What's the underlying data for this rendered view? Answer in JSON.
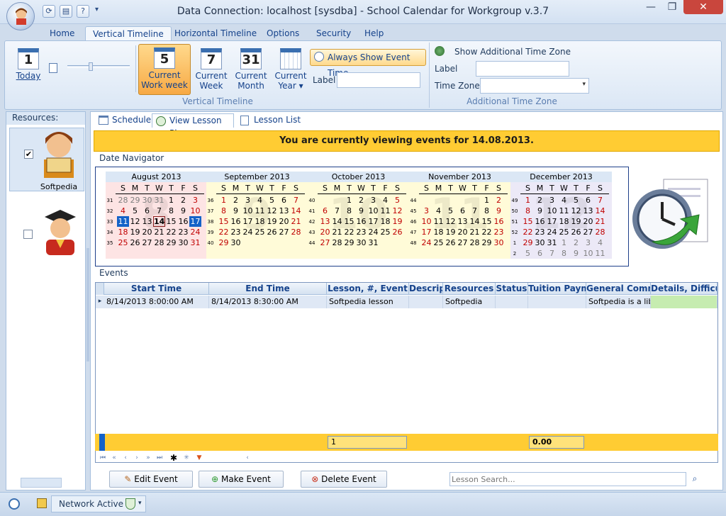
{
  "window": {
    "title": "Data Connection: localhost [sysdba] - School Calendar for Workgroup v.3.7"
  },
  "ribbon_tabs": [
    "Home",
    "Vertical Timeline",
    "Horizontal Timeline",
    "Options",
    "Security",
    "Help"
  ],
  "ribbon": {
    "today_num": "1",
    "today_label": "Today",
    "work_week_num": "5",
    "work_week_label1": "Current",
    "work_week_label2": "Work week",
    "week_num": "7",
    "week_label1": "Current",
    "week_label2": "Week",
    "month_num": "31",
    "month_label1": "Current",
    "month_label2": "Month",
    "year_label1": "Current",
    "year_label2": "Year",
    "always_show": "Always Show Event Time",
    "label_caption": "Label",
    "group_vertical": "Vertical Timeline",
    "show_additional": "Show Additional Time Zone",
    "tz_label": "Label",
    "tz_zone": "Time Zone",
    "group_additional": "Additional Time Zone"
  },
  "sidebar": {
    "header": "Resources:",
    "items": [
      {
        "name": "Softpedia",
        "checked": "✔"
      },
      {
        "name": "",
        "checked": ""
      }
    ]
  },
  "content_tabs": [
    "Scheduler",
    "View Lesson Plans",
    "Lesson List"
  ],
  "banner": "You are currently viewing events for 14.08.2013.",
  "date_navigator_label": "Date Navigator",
  "events_label": "Events",
  "day_headers": [
    "S",
    "M",
    "T",
    "W",
    "T",
    "F",
    "S"
  ],
  "months": [
    {
      "title": "August 2013",
      "bg": "8",
      "weeks": [
        "31",
        "32",
        "33",
        "34",
        "35"
      ],
      "rows": [
        [
          "28",
          "29",
          "30",
          "31",
          "1",
          "2",
          "3"
        ],
        [
          "4",
          "5",
          "6",
          "7",
          "8",
          "9",
          "10"
        ],
        [
          "11",
          "12",
          "13",
          "14",
          "15",
          "16",
          "17"
        ],
        [
          "18",
          "19",
          "20",
          "21",
          "22",
          "23",
          "24"
        ],
        [
          "25",
          "26",
          "27",
          "28",
          "29",
          "30",
          "31"
        ]
      ]
    },
    {
      "title": "September 2013",
      "bg": "9",
      "weeks": [
        "36",
        "37",
        "38",
        "39",
        "40"
      ],
      "rows": [
        [
          "1",
          "2",
          "3",
          "4",
          "5",
          "6",
          "7"
        ],
        [
          "8",
          "9",
          "10",
          "11",
          "12",
          "13",
          "14"
        ],
        [
          "15",
          "16",
          "17",
          "18",
          "19",
          "20",
          "21"
        ],
        [
          "22",
          "23",
          "24",
          "25",
          "26",
          "27",
          "28"
        ],
        [
          "29",
          "30",
          "",
          "",
          "",
          "",
          ""
        ]
      ]
    },
    {
      "title": "October 2013",
      "bg": "10",
      "weeks": [
        "40",
        "41",
        "42",
        "43",
        "44"
      ],
      "rows": [
        [
          "",
          "",
          "1",
          "2",
          "3",
          "4",
          "5"
        ],
        [
          "6",
          "7",
          "8",
          "9",
          "10",
          "11",
          "12"
        ],
        [
          "13",
          "14",
          "15",
          "16",
          "17",
          "18",
          "19"
        ],
        [
          "20",
          "21",
          "22",
          "23",
          "24",
          "25",
          "26"
        ],
        [
          "27",
          "28",
          "29",
          "30",
          "31",
          "",
          ""
        ]
      ]
    },
    {
      "title": "November 2013",
      "bg": "11",
      "weeks": [
        "44",
        "45",
        "46",
        "47",
        "48"
      ],
      "rows": [
        [
          "",
          "",
          "",
          "",
          "",
          "1",
          "2"
        ],
        [
          "3",
          "4",
          "5",
          "6",
          "7",
          "8",
          "9"
        ],
        [
          "10",
          "11",
          "12",
          "13",
          "14",
          "15",
          "16"
        ],
        [
          "17",
          "18",
          "19",
          "20",
          "21",
          "22",
          "23"
        ],
        [
          "24",
          "25",
          "26",
          "27",
          "28",
          "29",
          "30"
        ]
      ]
    },
    {
      "title": "December 2013",
      "bg": "12",
      "weeks": [
        "49",
        "50",
        "51",
        "52",
        "1",
        "2"
      ],
      "rows": [
        [
          "1",
          "2",
          "3",
          "4",
          "5",
          "6",
          "7"
        ],
        [
          "8",
          "9",
          "10",
          "11",
          "12",
          "13",
          "14"
        ],
        [
          "15",
          "16",
          "17",
          "18",
          "19",
          "20",
          "21"
        ],
        [
          "22",
          "23",
          "24",
          "25",
          "26",
          "27",
          "28"
        ],
        [
          "29",
          "30",
          "31",
          "1",
          "2",
          "3",
          "4"
        ],
        [
          "5",
          "6",
          "7",
          "8",
          "9",
          "10",
          "11"
        ]
      ]
    }
  ],
  "grid": {
    "headers": [
      "Start Time",
      "End Time",
      "Lesson, #, Event",
      "Descrip",
      "Resources",
      "Status",
      "Tuition Payme",
      "General Comme",
      "Details, Difficul"
    ],
    "row": [
      "8/14/2013 8:00:00 AM",
      "8/14/2013 8:30:00 AM",
      "Softpedia lesson",
      "",
      "Softpedia",
      "",
      "",
      "Softpedia is a libra",
      ""
    ],
    "footer_count": "1",
    "footer_sum": "0.00"
  },
  "actions": {
    "edit": "Edit Event",
    "make": "Make Event",
    "delete": "Delete Event",
    "search_placeholder": "Lesson Search..."
  },
  "status": {
    "network": "Network Active"
  },
  "colors": {
    "banner": "#ffcc33",
    "selected": "#1462c8",
    "weekend": "#c00000"
  }
}
